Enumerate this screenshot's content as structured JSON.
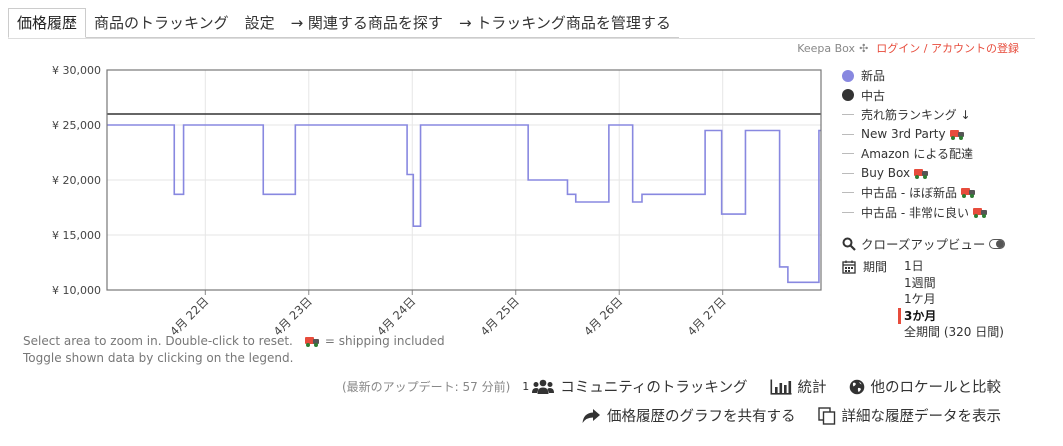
{
  "tabs": [
    {
      "label": "価格履歴",
      "active": true
    },
    {
      "label": "商品のトラッキング"
    },
    {
      "label": "設定"
    },
    {
      "label": "→ 関連する商品を探す"
    },
    {
      "label": "→ トラッキング商品を管理する"
    }
  ],
  "header": {
    "brand": "Keepa Box",
    "login": "ログイン / アカウントの登録"
  },
  "chart_data": {
    "type": "line",
    "title": "",
    "xlabel": "",
    "ylabel": "",
    "ylim": [
      10000,
      30000
    ],
    "y_ticks": [
      "¥ 30,000",
      "¥ 25,000",
      "¥ 20,000",
      "¥ 15,000",
      "¥ 10,000"
    ],
    "y_tick_values": [
      30000,
      25000,
      20000,
      15000,
      10000
    ],
    "x_ticks": [
      "4月 22日",
      "4月 23日",
      "4月 24日",
      "4月 25日",
      "4月 26日",
      "4月 27日"
    ],
    "xlim_days": [
      21.05,
      27.95
    ],
    "grid": true,
    "series": [
      {
        "name": "新品",
        "color": "#8888e0",
        "step": true,
        "x": [
          21.05,
          21.7,
          21.79,
          22.56,
          22.87,
          23.95,
          24.01,
          24.08,
          24.75,
          25.12,
          25.5,
          25.58,
          25.9,
          26.13,
          26.22,
          26.83,
          26.99,
          27.22,
          27.55,
          27.63,
          27.93
        ],
        "y": [
          25000,
          18700,
          25000,
          18700,
          25000,
          20500,
          15800,
          25000,
          25000,
          20000,
          18700,
          18000,
          25000,
          18000,
          18700,
          24500,
          16900,
          24500,
          12100,
          10700,
          24500
        ]
      },
      {
        "name": "中古",
        "color": "#333333",
        "step": true,
        "x": [
          21.05,
          27.95
        ],
        "y": [
          26000,
          26000
        ]
      }
    ]
  },
  "legend": {
    "items": [
      {
        "label": "新品",
        "kind": "dot",
        "color": "#8888e0"
      },
      {
        "label": "中古",
        "kind": "dot",
        "color": "#333333"
      },
      {
        "label": "売れ筋ランキング ↓",
        "kind": "dash"
      },
      {
        "label": "New 3rd Party",
        "kind": "dash",
        "truck": true
      },
      {
        "label": "Amazon による配達",
        "kind": "dash"
      },
      {
        "label": "Buy Box",
        "kind": "dash",
        "truck": true
      },
      {
        "label": "中古品 - ほぼ新品",
        "kind": "dash",
        "truck": true
      },
      {
        "label": "中古品 - 非常に良い",
        "kind": "dash",
        "truck": true
      }
    ],
    "closeup_label": "クローズアップビュー",
    "range_label": "期間",
    "range_options": [
      "1日",
      "1週間",
      "1ケ月",
      "3か月",
      "全期間 (320 日間)"
    ],
    "range_selected": "3か月"
  },
  "hint": {
    "line1_a": "Select area to zoom in. Double-click to reset.",
    "line1_b": "= shipping included",
    "line2": "Toggle shown data by clicking on the legend."
  },
  "footer": {
    "last_update": "(最新のアップデート: 57 分前)",
    "tracking_count": "1",
    "community_tracking": "コミュニティのトラッキング",
    "stats": "統計",
    "compare_locales": "他のロケールと比較",
    "share_graph": "価格履歴のグラフを共有する",
    "detailed_data": "詳細な履歴データを表示"
  },
  "colors": {
    "accent": "#e74c3c",
    "new_series": "#8888e0",
    "used_series": "#333333"
  }
}
